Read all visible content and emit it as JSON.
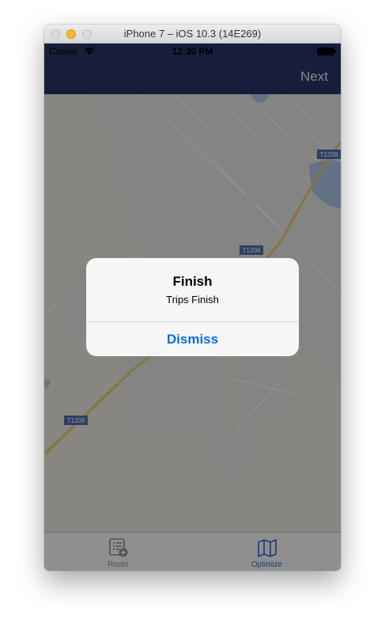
{
  "window": {
    "title": "iPhone 7 – iOS 10.3 (14E269)"
  },
  "status_bar": {
    "carrier": "Carrier",
    "time": "12:30 PM"
  },
  "nav_bar": {
    "next_label": "Next",
    "background_color": "#263466"
  },
  "map": {
    "road_labels": [
      "T1208",
      "T1208",
      "T1208"
    ]
  },
  "tab_bar": {
    "items": [
      {
        "label": "Route",
        "icon": "route-list-add-icon",
        "selected": false
      },
      {
        "label": "Optimize",
        "icon": "map-icon",
        "selected": true
      }
    ],
    "selected_color": "#2a68c9",
    "unselected_color": "#8e8e8e"
  },
  "alert": {
    "title": "Finish",
    "message": "Trips Finish",
    "button_label": "Dismiss",
    "button_color": "#0a6fe0"
  }
}
